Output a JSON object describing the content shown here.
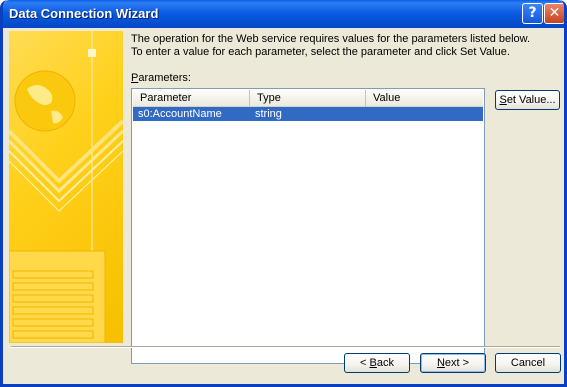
{
  "window": {
    "title": "Data Connection Wizard"
  },
  "titlebar": {
    "help_glyph": "?",
    "close_glyph": "✕"
  },
  "instructions": {
    "line1": "The operation for the Web service requires values for the parameters listed below.",
    "line2": "To enter a value for each parameter, select the parameter and click Set Value."
  },
  "parameters": {
    "label_hotkey": "P",
    "label_rest": "arameters:",
    "columns": {
      "parameter": "Parameter",
      "type": "Type",
      "value": "Value"
    },
    "rows": [
      {
        "parameter": "s0:AccountName",
        "type": "string",
        "value": ""
      }
    ]
  },
  "buttons": {
    "set_value_hotkey": "S",
    "set_value_rest": "et Value...",
    "back_prefix": "< ",
    "back_hotkey": "B",
    "back_rest": "ack",
    "next_hotkey": "N",
    "next_rest": "ext >",
    "cancel": "Cancel"
  },
  "colors": {
    "title_bar": "#0b5ce3",
    "selection": "#316ac5",
    "banner": "#ffd01a",
    "dialog_face": "#ece9d8"
  }
}
